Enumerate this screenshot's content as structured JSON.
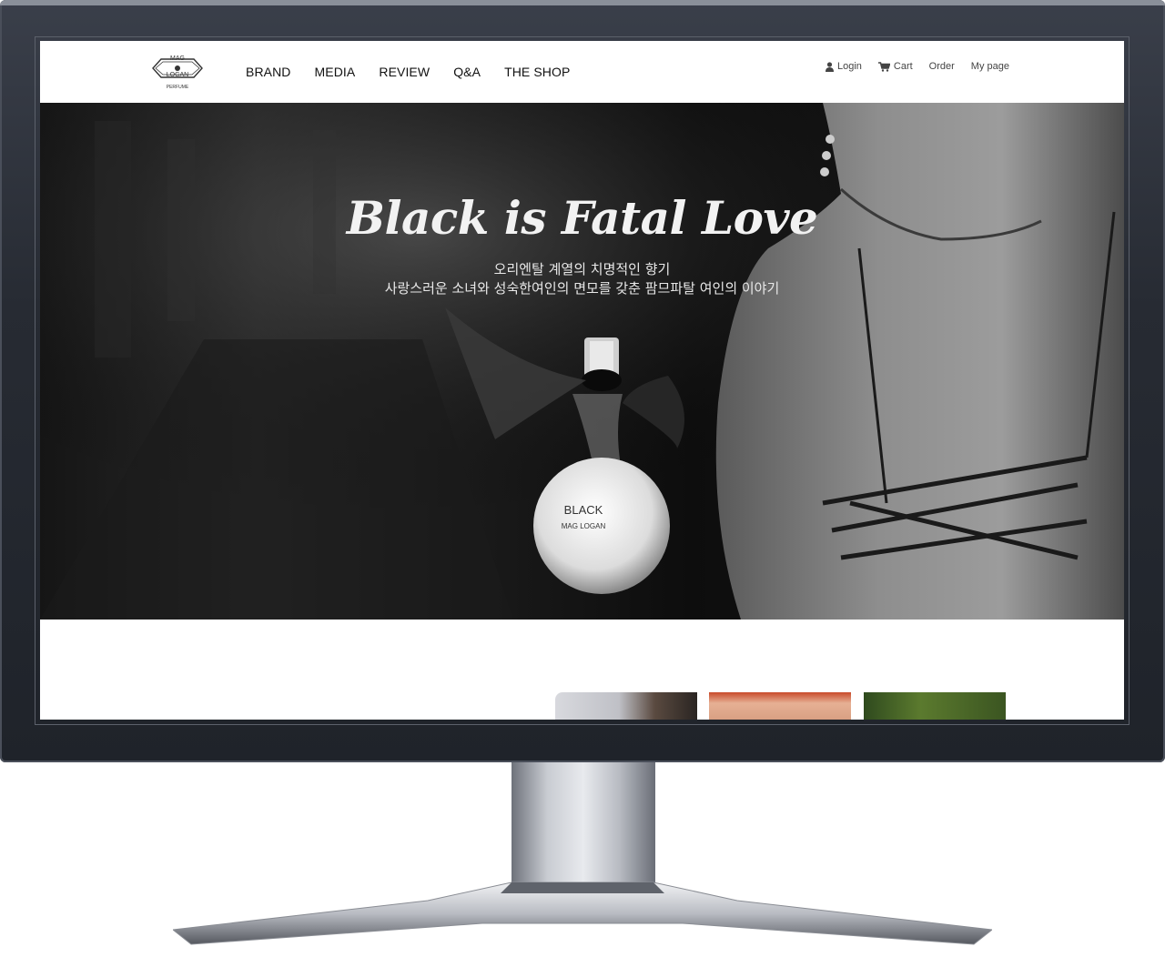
{
  "logo": {
    "line1": "MAG",
    "line2": "LOGAN",
    "line3": "PERFUME"
  },
  "nav": {
    "items": [
      {
        "label": "BRAND"
      },
      {
        "label": "MEDIA"
      },
      {
        "label": "REVIEW"
      },
      {
        "label": "Q&A"
      },
      {
        "label": "THE SHOP"
      }
    ]
  },
  "util": {
    "login": "Login",
    "cart": "Cart",
    "order": "Order",
    "mypage": "My page"
  },
  "hero": {
    "headline": "Black is Fatal Love",
    "sub1": "오리엔탈 계열의 치명적인 향기",
    "sub2": "사랑스러운 소녀와 성숙한여인의 면모를 갖춘 팜므파탈 여인의 이야기",
    "bottle_name": "BLACK",
    "bottle_brand": "MAG LOGAN"
  },
  "colors": {
    "bezel": "#272b33",
    "hero_bg": "#151515",
    "text_dark": "#111111"
  }
}
